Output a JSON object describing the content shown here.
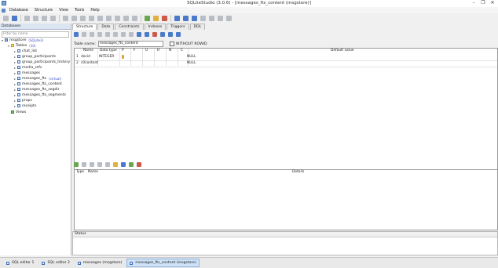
{
  "window": {
    "title": "SQLiteStudio (3.0.6) - [messages_fts_content (msgstore)]",
    "min": "–",
    "max": "❐",
    "close": "✕"
  },
  "menu": [
    "Database",
    "Structure",
    "View",
    "Tools",
    "Help"
  ],
  "left": {
    "header": "Databases",
    "filter_placeholder": "Filter by name",
    "db": {
      "name": "msgstore",
      "note": "(SQLite3)"
    },
    "tables_label": "Tables",
    "tables_count": "(10)",
    "tables": [
      "chat_list",
      "group_participants",
      "group_participants_history",
      "media_refs",
      "messages",
      "messages_fts",
      "messages_fts_content",
      "messages_fts_segdir",
      "messages_fts_segments",
      "props",
      "receipts"
    ],
    "messages_fts_note": "(virtual)",
    "views_label": "Views"
  },
  "tabs": [
    "Structure",
    "Data",
    "Constraints",
    "Indexes",
    "Triggers",
    "DDL"
  ],
  "table_name_label": "Table name:",
  "table_name_value": "messages_fts_content",
  "without_rowid": "WITHOUT ROWID",
  "columns_header": [
    "Name",
    "Data type",
    "P",
    "F",
    "U",
    "H",
    "N",
    "C",
    "Default value"
  ],
  "rows": [
    {
      "num": "1",
      "name": "docid",
      "type": "INTEGER",
      "default": "NULL",
      "pk": true
    },
    {
      "num": "2",
      "name": "c0content",
      "type": "",
      "default": "NULL",
      "pk": false
    }
  ],
  "lower_header": [
    "Type",
    "Name",
    "Details"
  ],
  "status_label": "Status",
  "taskbar": [
    "SQL editor 1",
    "SQL editor 2",
    "messages (msgstore)",
    "messages_fts_content (msgstore)"
  ]
}
